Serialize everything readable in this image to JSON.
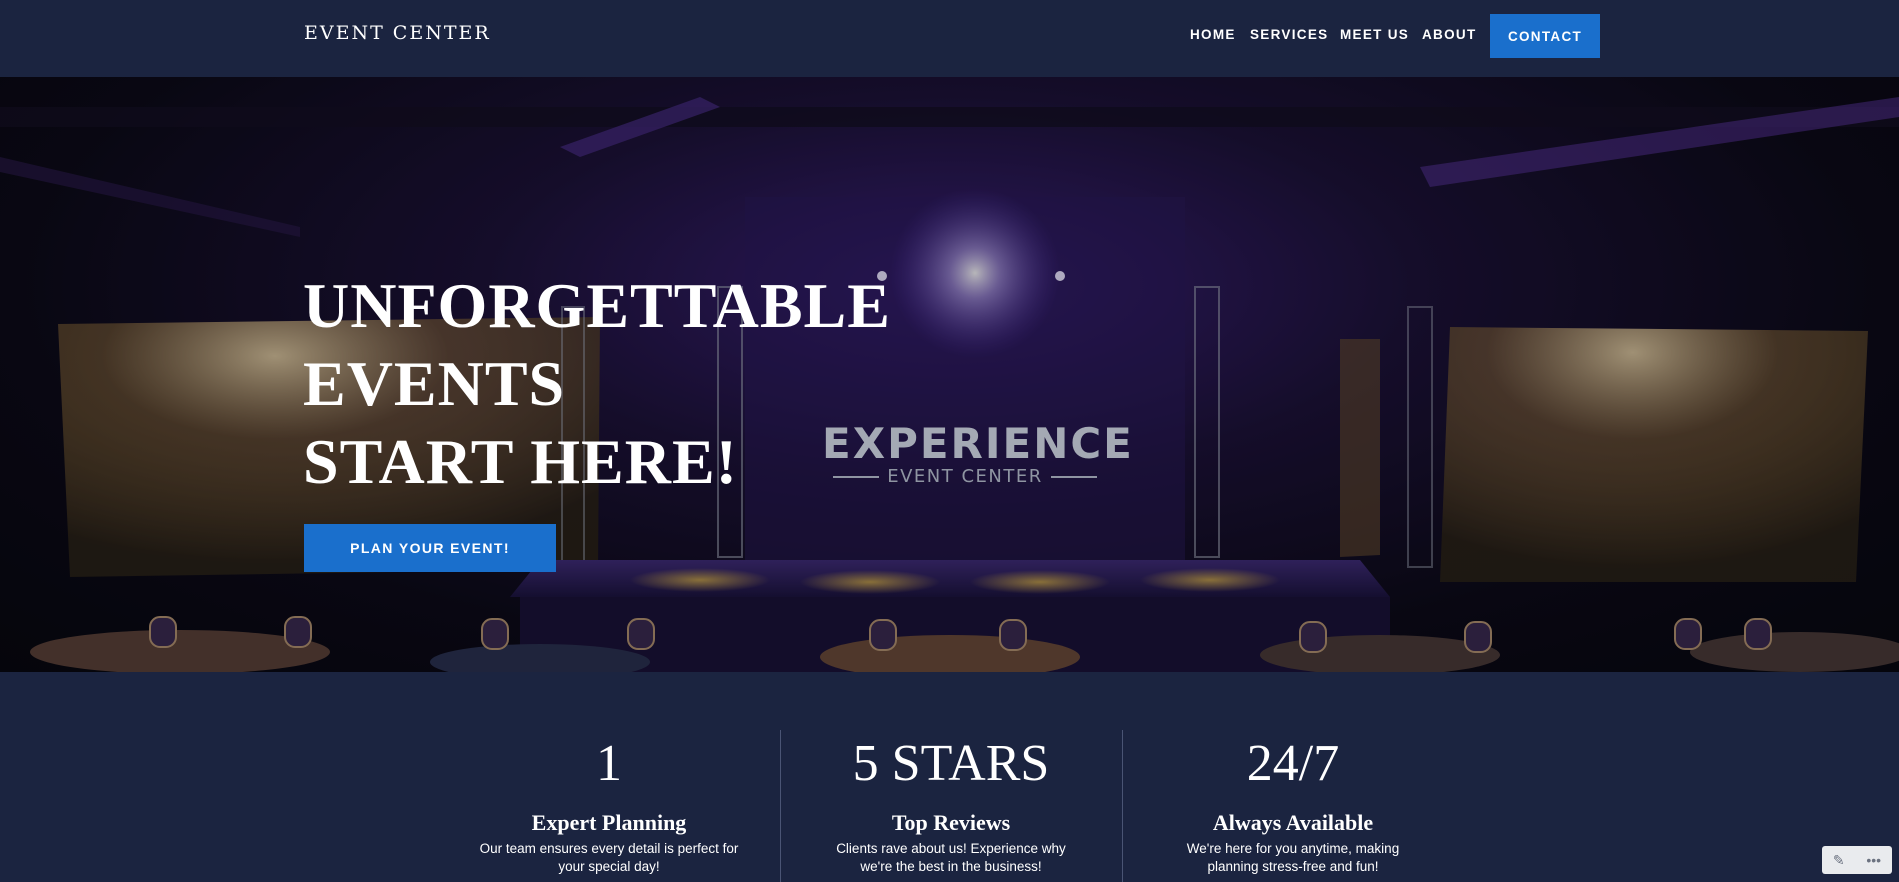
{
  "navbar": {
    "brand": "EVENT CENTER",
    "links": [
      "HOME",
      "SERVICES",
      "MEET US",
      "ABOUT"
    ],
    "contact_label": "CONTACT"
  },
  "hero": {
    "title_lines": [
      "UNFORGETTABLE",
      "EVENTS",
      "START HERE!"
    ],
    "cta_label": "PLAN YOUR EVENT!",
    "stage_logo_main": "EXPERIENCE",
    "stage_logo_sub": "EVENT CENTER"
  },
  "stats": [
    {
      "number": "1",
      "title": "Expert Planning",
      "desc": "Our team ensures every detail is perfect for your special day!"
    },
    {
      "number": "5 STARS",
      "title": "Top Reviews",
      "desc": "Clients rave about us! Experience why we're the best in the business!"
    },
    {
      "number": "24/7",
      "title": "Always Available",
      "desc": "We're here for you anytime, making planning stress-free and fun!"
    }
  ],
  "edit_widget": {
    "icons": [
      "pencil-icon",
      "more-icon"
    ],
    "pencil_glyph": "✎",
    "more_glyph": "•••"
  },
  "colors": {
    "navy": "#1b2440",
    "accent_blue": "#1a6fcc",
    "stage_purple": "#3a1f78"
  }
}
